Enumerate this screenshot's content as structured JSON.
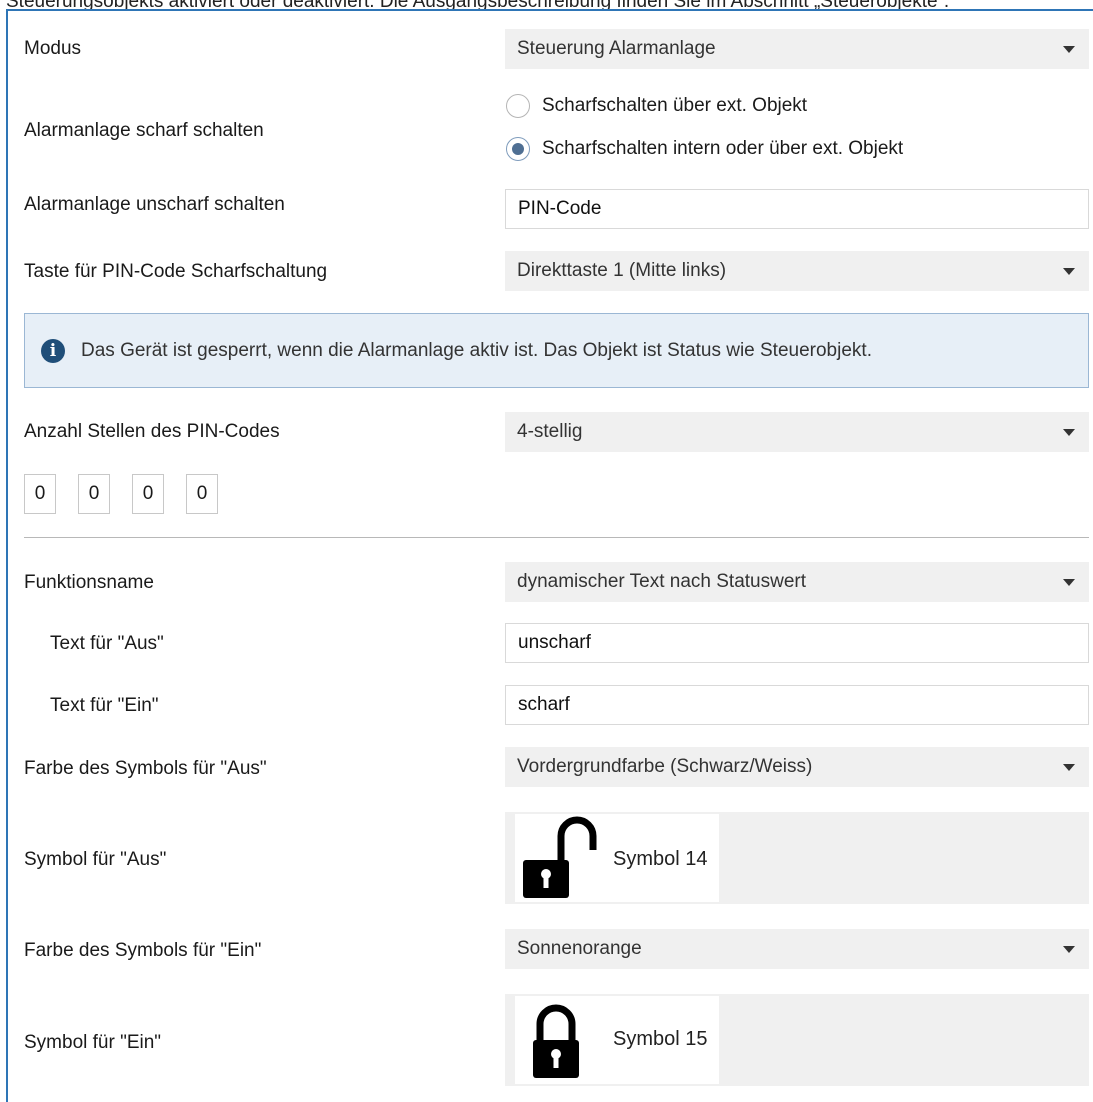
{
  "top_text": "Steuerungsobjekts aktiviert oder deaktiviert. Die Ausgangsbeschreibung finden Sie im Abschnitt „Steuerobjekte“.",
  "form": {
    "modus": {
      "label": "Modus",
      "value": "Steuerung Alarmanlage"
    },
    "scharf": {
      "label": "Alarmanlage scharf schalten",
      "options": [
        "Scharfschalten über ext. Objekt",
        "Scharfschalten intern oder über ext. Objekt"
      ],
      "selected_index": 1
    },
    "unscharf": {
      "label": "Alarmanlage unscharf schalten",
      "value": "PIN-Code"
    },
    "taste": {
      "label": "Taste für PIN-Code Scharfschaltung",
      "value": "Direkttaste 1 (Mitte links)"
    },
    "info": {
      "icon": "info-icon",
      "text": "Das Gerät ist gesperrt, wenn die Alarmanlage aktiv ist. Das Objekt ist Status wie Steuerobjekt."
    },
    "anzahl": {
      "label": "Anzahl Stellen des PIN-Codes",
      "value": "4-stellig"
    },
    "pin_digits": [
      "0",
      "0",
      "0",
      "0"
    ],
    "funktionsname": {
      "label": "Funktionsname",
      "value": "dynamischer Text nach Statuswert"
    },
    "text_aus": {
      "label": "Text für \"Aus\"",
      "value": "unscharf"
    },
    "text_ein": {
      "label": "Text für \"Ein\"",
      "value": "scharf"
    },
    "farbe_aus": {
      "label": "Farbe des Symbols für \"Aus\"",
      "value": "Vordergrundfarbe (Schwarz/Weiss)"
    },
    "symbol_aus": {
      "label": "Symbol für \"Aus\"",
      "value": "Symbol 14",
      "icon": "unlocked-padlock-icon"
    },
    "farbe_ein": {
      "label": "Farbe des Symbols für \"Ein\"",
      "value": "Sonnenorange"
    },
    "symbol_ein": {
      "label": "Symbol für \"Ein\"",
      "value": "Symbol 15",
      "icon": "locked-padlock-icon"
    }
  },
  "colors": {
    "accent_border": "#2e75b6",
    "select_bg": "#f0f0f0",
    "info_bg": "#e7eff7",
    "info_icon": "#1f4e79"
  }
}
